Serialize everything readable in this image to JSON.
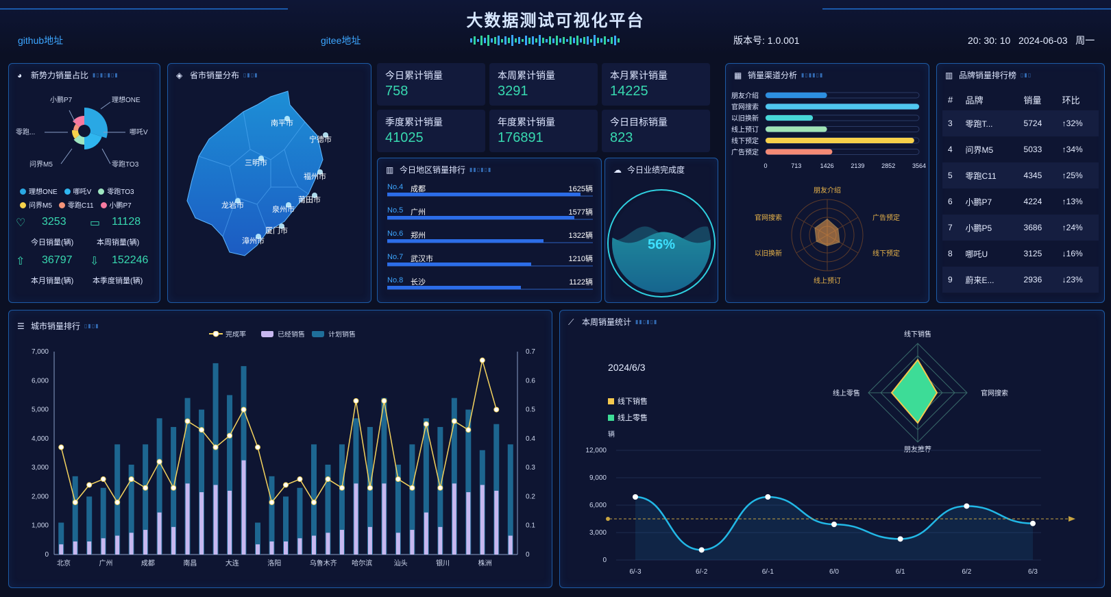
{
  "header": {
    "title": "大数据测试可视化平台",
    "github": "github地址",
    "gitee": "gitee地址",
    "version": "版本号: 1.0.001",
    "datetime": "20: 30: 10   2024-06-03   周一"
  },
  "panel_pie": {
    "title": "新势力销量占比",
    "slices": [
      {
        "name": "理想ONE",
        "value": 30,
        "color": "#2aa8e4"
      },
      {
        "name": "哪吒V",
        "value": 20,
        "color": "#2fb6ef"
      },
      {
        "name": "零跑TO3",
        "value": 14,
        "color": "#9ee6c0"
      },
      {
        "name": "问界M5",
        "value": 12,
        "color": "#f6d24b"
      },
      {
        "name": "零跑C11",
        "value": 10,
        "color": "#f5957a"
      },
      {
        "name": "小鹏P7",
        "value": 14,
        "color": "#f77aa0"
      }
    ],
    "callouts": {
      "p7": "小鹏P7",
      "one": "理想ONE",
      "lingpao": "零跑...",
      "nezha": "哪吒V",
      "m5": "问界M5",
      "to3": "零跑TO3"
    },
    "legend_row1": [
      "理想ONE",
      "哪吒V",
      "零跑TO3"
    ],
    "legend_row2": [
      "问界M5",
      "零跑C11",
      "小鹏P7"
    ],
    "day_val": "3253",
    "week_val": "11128",
    "day_label": "今日销量(辆)",
    "week_label": "本周销量(辆)",
    "month_val": "36797",
    "quarter_val": "152246",
    "month_label": "本月销量(辆)",
    "quarter_label": "本季度销量(辆)"
  },
  "panel_map": {
    "title": "省市销量分布",
    "cities": [
      "南平市",
      "宁德市",
      "三明市",
      "福州市",
      "莆田市",
      "龙岩市",
      "泉州市",
      "厦门市",
      "漳州市"
    ]
  },
  "stats": [
    {
      "label": "今日累计销量",
      "value": "758"
    },
    {
      "label": "本周累计销量",
      "value": "3291"
    },
    {
      "label": "本月累计销量",
      "value": "14225"
    },
    {
      "label": "季度累计销量",
      "value": "41025"
    },
    {
      "label": "年度累计销量",
      "value": "176891"
    },
    {
      "label": "今日目标销量",
      "value": "823"
    }
  ],
  "region_rank": {
    "title": "今日地区销量排行",
    "items": [
      {
        "no": "No.4",
        "city": "成都",
        "value": "1625辆",
        "pct": 0.94
      },
      {
        "no": "No.5",
        "city": "广州",
        "value": "1577辆",
        "pct": 0.91
      },
      {
        "no": "No.6",
        "city": "郑州",
        "value": "1322辆",
        "pct": 0.76
      },
      {
        "no": "No.7",
        "city": "武汉市",
        "value": "1210辆",
        "pct": 0.7
      },
      {
        "no": "No.8",
        "city": "长沙",
        "value": "1122辆",
        "pct": 0.65
      }
    ]
  },
  "completion": {
    "title": "今日业绩完成度",
    "percent": "56%",
    "fraction": 0.56
  },
  "channel": {
    "title": "销量渠道分析",
    "bars": [
      {
        "name": "朋友介绍",
        "value": 1426,
        "color": "#2d8fe0"
      },
      {
        "name": "官网搜索",
        "value": 3564,
        "color": "#4fc7f0"
      },
      {
        "name": "以旧换新",
        "value": 1100,
        "color": "#47d7d7"
      },
      {
        "name": "线上预订",
        "value": 1426,
        "color": "#9fe3b5"
      },
      {
        "name": "线下预定",
        "value": 3450,
        "color": "#f7d04a"
      },
      {
        "name": "广告预定",
        "value": 1550,
        "color": "#f48a75"
      }
    ],
    "ticks": [
      "0",
      "713",
      "1426",
      "2139",
      "2852",
      "3564"
    ],
    "radar_labels": [
      "朋友介绍",
      "广告预定",
      "线下预定",
      "线上预订",
      "以旧换新",
      "官网搜索"
    ]
  },
  "brand_rank": {
    "title": "品牌销量排行榜",
    "headers": [
      "#",
      "品牌",
      "销量",
      "环比"
    ],
    "rows": [
      {
        "rank": "3",
        "brand": "零跑T...",
        "sales": "5724",
        "change": "↑32%",
        "dir": "up"
      },
      {
        "rank": "4",
        "brand": "问界M5",
        "sales": "5033",
        "change": "↑34%",
        "dir": "up"
      },
      {
        "rank": "5",
        "brand": "零跑C11",
        "sales": "4345",
        "change": "↑25%",
        "dir": "up"
      },
      {
        "rank": "6",
        "brand": "小鹏P7",
        "sales": "4224",
        "change": "↑13%",
        "dir": "up"
      },
      {
        "rank": "7",
        "brand": "小鹏P5",
        "sales": "3686",
        "change": "↑24%",
        "dir": "up"
      },
      {
        "rank": "8",
        "brand": "哪吒U",
        "sales": "3125",
        "change": "↓16%",
        "dir": "down"
      },
      {
        "rank": "9",
        "brand": "蔚来E...",
        "sales": "2936",
        "change": "↓23%",
        "dir": "down"
      }
    ]
  },
  "city_chart_title": "城市销量排行",
  "week_chart_title": "本周销量统计",
  "chart_data": [
    {
      "type": "bar",
      "title": "城市销量排行",
      "legend": [
        "完成率",
        "已经销售",
        "计划销售"
      ],
      "categories": [
        "北京",
        "",
        "广州",
        "",
        "成都",
        "",
        "南昌",
        "",
        "大连",
        "",
        "洛阳",
        "",
        "乌鲁木齐",
        "",
        "哈尔滨",
        "",
        "汕头",
        "",
        "银川",
        "",
        "株洲",
        ""
      ],
      "ylim": [
        0,
        7000
      ],
      "y2lim": [
        0,
        0.7
      ],
      "yticks": [
        "7,000",
        "6,000",
        "5,000",
        "4,000",
        "3,000",
        "2,000",
        "1,000",
        "0"
      ],
      "y2ticks": [
        "0.7",
        "0.6",
        "0.5",
        "0.4",
        "0.3",
        "0.2",
        "0.1",
        "0"
      ],
      "series": [
        {
          "name": "计划销售",
          "values": [
            1100,
            2700,
            2000,
            2300,
            3800,
            3100,
            3800,
            4700,
            4400,
            5400,
            5000,
            6600,
            5500,
            6500,
            1100,
            2700,
            2000,
            2300,
            3800,
            3100,
            3800,
            4700,
            4400,
            5400,
            3100,
            3800,
            4700,
            4400,
            5400,
            5000,
            3600,
            4500,
            3800
          ]
        },
        {
          "name": "已经销售",
          "values": [
            350,
            450,
            450,
            560,
            650,
            750,
            850,
            1450,
            950,
            2450,
            2150,
            2400,
            2200,
            3250,
            350,
            450,
            450,
            560,
            650,
            750,
            850,
            2450,
            950,
            2450,
            750,
            850,
            1450,
            950,
            2450,
            2150,
            2400,
            2200,
            650
          ]
        },
        {
          "name": "完成率",
          "values": [
            0.37,
            0.18,
            0.24,
            0.26,
            0.18,
            0.26,
            0.23,
            0.32,
            0.23,
            0.46,
            0.43,
            0.37,
            0.41,
            0.5,
            0.37,
            0.18,
            0.24,
            0.26,
            0.18,
            0.26,
            0.23,
            0.53,
            0.23,
            0.53,
            0.26,
            0.23,
            0.45,
            0.23,
            0.46,
            0.43,
            0.67,
            0.5
          ]
        }
      ]
    },
    {
      "type": "line",
      "title": "本周销量统计",
      "categories": [
        "6/-3",
        "6/-2",
        "6/-1",
        "6/0",
        "6/1",
        "6/2",
        "6/3"
      ],
      "ylabel": "辆",
      "ylim": [
        0,
        12000
      ],
      "yticks": [
        "12,000",
        "9,000",
        "6,000",
        "3,000",
        "0"
      ],
      "values": [
        6900,
        1100,
        6900,
        3900,
        2300,
        5900,
        4000
      ],
      "reference": 4500,
      "radar": {
        "date": "2024/6/3",
        "legend": [
          "线下销售",
          "线上零售"
        ],
        "labels": [
          "线下销售",
          "官网搜索",
          "朋友推荐",
          "线上零售"
        ]
      }
    }
  ],
  "colors": {
    "accent": "#38d9b0",
    "border": "#1d5ba6",
    "bar_blue": "#2c7ae8"
  }
}
